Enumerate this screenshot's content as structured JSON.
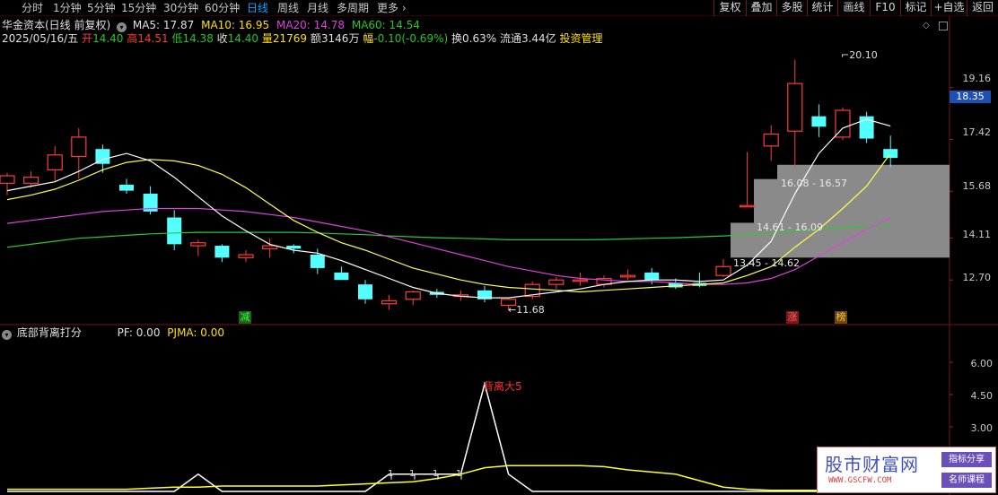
{
  "toolbar": {
    "periods": [
      "分时",
      "1分钟",
      "5分钟",
      "15分钟",
      "30分钟",
      "60分钟",
      "日线",
      "周线",
      "月线",
      "多周期",
      "更多"
    ],
    "active_period": "日线",
    "right_buttons": [
      "复权",
      "叠加",
      "多股",
      "统计",
      "画线",
      "F10",
      "标记",
      "+自选",
      "返回"
    ]
  },
  "header": {
    "stock_title": "华金资本(日线 前复权)",
    "ma5": "MA5: 17.87",
    "ma10": "MA10: 16.95",
    "ma20": "MA20: 14.78",
    "ma60": "MA60: 14.54",
    "date": "2025/05/16/五",
    "open_label": "开",
    "open": "14.40",
    "high_label": "高",
    "high": "14.51",
    "low_label": "低",
    "low": "14.38",
    "close_label": "收",
    "close": "14.40",
    "vol_label": "量",
    "vol": "21769",
    "amt_label": "额",
    "amt": "3146万",
    "chg_label": "幅",
    "chg": "-0.10(-0.69%)",
    "turnover": "换0.63%",
    "float": "流通3.44亿",
    "link": "投资管理"
  },
  "price_axis": [
    "19.16",
    "17.42",
    "15.68",
    "14.11",
    "12.70"
  ],
  "current_price": "18.35",
  "annotations": {
    "high_mark": "20.10",
    "low_mark": "11.68",
    "zone1": "16.08 - 16.57",
    "zone2": "14.61 - 16.09",
    "zone3": "13.45 - 14.62",
    "tag_jian": "减",
    "tag_zhang": "涨",
    "tag_bang": "榜"
  },
  "indicator": {
    "name": "底部背离打分",
    "pf": "PF: 0.00",
    "pjma": "PJMA: 0.00",
    "peak_label": "背离大5",
    "axis": [
      "6.00",
      "4.50",
      "3.00"
    ],
    "ticks": [
      "1",
      "1",
      "1",
      "1"
    ]
  },
  "watermark": {
    "title": "股市财富网",
    "url": "WWW.GSCFW.COM",
    "tag1": "指标分享",
    "tag2": "名师课程"
  },
  "colors": {
    "up": "#ff3c3c",
    "down": "#54ffff",
    "ma5": "#ffffff",
    "ma10": "#ffff50",
    "ma20": "#e040e0",
    "ma60": "#30c830"
  },
  "chart_data": {
    "type": "candlestick",
    "ylim": [
      11.0,
      21.0
    ],
    "candles": [
      {
        "o": 15.95,
        "h": 16.3,
        "l": 15.55,
        "c": 16.2,
        "up": true
      },
      {
        "o": 15.95,
        "h": 16.35,
        "l": 15.8,
        "c": 16.15,
        "up": true
      },
      {
        "o": 16.4,
        "h": 17.2,
        "l": 16.0,
        "c": 16.9,
        "up": true
      },
      {
        "o": 16.85,
        "h": 17.8,
        "l": 16.1,
        "c": 17.5,
        "up": true
      },
      {
        "o": 17.1,
        "h": 17.25,
        "l": 16.3,
        "c": 16.6,
        "up": false
      },
      {
        "o": 15.9,
        "h": 16.1,
        "l": 15.6,
        "c": 15.7,
        "up": false
      },
      {
        "o": 15.6,
        "h": 15.85,
        "l": 14.9,
        "c": 15.0,
        "up": false
      },
      {
        "o": 14.8,
        "h": 15.05,
        "l": 13.7,
        "c": 13.9,
        "up": false
      },
      {
        "o": 13.85,
        "h": 14.05,
        "l": 13.5,
        "c": 13.95,
        "up": true
      },
      {
        "o": 13.85,
        "h": 13.9,
        "l": 13.3,
        "c": 13.45,
        "up": false
      },
      {
        "o": 13.45,
        "h": 13.7,
        "l": 13.3,
        "c": 13.55,
        "up": true
      },
      {
        "o": 13.75,
        "h": 14.1,
        "l": 13.45,
        "c": 13.85,
        "up": true
      },
      {
        "o": 13.85,
        "h": 13.9,
        "l": 13.6,
        "c": 13.75,
        "up": false
      },
      {
        "o": 13.55,
        "h": 13.75,
        "l": 12.9,
        "c": 13.1,
        "up": false
      },
      {
        "o": 12.95,
        "h": 13.15,
        "l": 12.7,
        "c": 12.7,
        "up": false
      },
      {
        "o": 12.55,
        "h": 12.7,
        "l": 11.9,
        "c": 12.05,
        "up": false
      },
      {
        "o": 11.9,
        "h": 12.2,
        "l": 11.7,
        "c": 12.0,
        "up": true
      },
      {
        "o": 12.05,
        "h": 12.35,
        "l": 11.85,
        "c": 12.3,
        "up": true
      },
      {
        "o": 12.3,
        "h": 12.4,
        "l": 12.1,
        "c": 12.2,
        "up": false
      },
      {
        "o": 12.15,
        "h": 12.35,
        "l": 12.0,
        "c": 12.2,
        "up": true
      },
      {
        "o": 12.35,
        "h": 12.5,
        "l": 11.95,
        "c": 12.05,
        "up": false
      },
      {
        "o": 11.85,
        "h": 12.1,
        "l": 11.68,
        "c": 12.05,
        "up": true
      },
      {
        "o": 12.15,
        "h": 12.65,
        "l": 12.05,
        "c": 12.55,
        "up": true
      },
      {
        "o": 12.55,
        "h": 12.8,
        "l": 12.4,
        "c": 12.7,
        "up": true
      },
      {
        "o": 12.7,
        "h": 12.95,
        "l": 12.5,
        "c": 12.7,
        "up": true
      },
      {
        "o": 12.55,
        "h": 12.85,
        "l": 12.45,
        "c": 12.75,
        "up": true
      },
      {
        "o": 12.8,
        "h": 13.05,
        "l": 12.7,
        "c": 12.85,
        "up": true
      },
      {
        "o": 12.95,
        "h": 13.1,
        "l": 12.55,
        "c": 12.7,
        "up": false
      },
      {
        "o": 12.6,
        "h": 12.75,
        "l": 12.4,
        "c": 12.45,
        "up": false
      },
      {
        "o": 12.6,
        "h": 12.95,
        "l": 12.45,
        "c": 12.5,
        "up": false
      },
      {
        "o": 12.85,
        "h": 13.4,
        "l": 12.8,
        "c": 13.15,
        "up": true
      },
      {
        "o": 15.2,
        "h": 17.0,
        "l": 15.2,
        "c": 15.2,
        "up": true
      },
      {
        "o": 17.2,
        "h": 17.9,
        "l": 16.7,
        "c": 17.6,
        "up": true
      },
      {
        "o": 17.7,
        "h": 20.1,
        "l": 16.5,
        "c": 19.3,
        "up": true
      },
      {
        "o": 18.2,
        "h": 18.6,
        "l": 17.5,
        "c": 17.85,
        "up": false
      },
      {
        "o": 17.5,
        "h": 18.5,
        "l": 17.4,
        "c": 18.4,
        "up": true
      },
      {
        "o": 18.2,
        "h": 18.35,
        "l": 17.3,
        "c": 17.45,
        "up": false
      },
      {
        "o": 17.1,
        "h": 17.55,
        "l": 16.5,
        "c": 16.8,
        "up": false
      }
    ],
    "ma5": [
      15.7,
      15.85,
      16.0,
      16.35,
      16.75,
      16.95,
      16.7,
      16.15,
      15.5,
      14.85,
      14.35,
      13.9,
      13.7,
      13.6,
      13.35,
      13.05,
      12.75,
      12.45,
      12.25,
      12.15,
      12.1,
      12.1,
      12.2,
      12.3,
      12.4,
      12.55,
      12.65,
      12.7,
      12.7,
      12.65,
      12.7,
      13.2,
      14.0,
      15.6,
      16.95,
      17.8,
      18.1,
      17.87
    ],
    "ma10": [
      15.4,
      15.55,
      15.75,
      16.05,
      16.4,
      16.65,
      16.75,
      16.7,
      16.55,
      16.25,
      15.8,
      15.25,
      14.7,
      14.3,
      13.95,
      13.7,
      13.4,
      13.1,
      12.9,
      12.7,
      12.55,
      12.45,
      12.4,
      12.35,
      12.3,
      12.35,
      12.4,
      12.45,
      12.5,
      12.55,
      12.6,
      12.85,
      13.15,
      13.8,
      14.4,
      15.1,
      15.85,
      16.95
    ],
    "ma20": [
      14.6,
      14.7,
      14.8,
      14.9,
      15.0,
      15.05,
      15.1,
      15.1,
      15.1,
      15.05,
      15.0,
      14.9,
      14.8,
      14.65,
      14.5,
      14.35,
      14.15,
      13.95,
      13.75,
      13.55,
      13.35,
      13.15,
      13.0,
      12.85,
      12.75,
      12.7,
      12.65,
      12.65,
      12.6,
      12.55,
      12.55,
      12.6,
      12.75,
      13.05,
      13.5,
      13.95,
      14.4,
      14.78
    ],
    "ma60": [
      13.8,
      13.9,
      14.0,
      14.1,
      14.15,
      14.2,
      14.25,
      14.28,
      14.3,
      14.3,
      14.3,
      14.3,
      14.3,
      14.28,
      14.25,
      14.22,
      14.18,
      14.15,
      14.12,
      14.1,
      14.08,
      14.05,
      14.05,
      14.05,
      14.05,
      14.06,
      14.08,
      14.1,
      14.12,
      14.15,
      14.18,
      14.22,
      14.28,
      14.35,
      14.4,
      14.45,
      14.5,
      14.54
    ],
    "indicator_pf": [
      0,
      0,
      0,
      0,
      0,
      0,
      0,
      0,
      0.8,
      0,
      0,
      0,
      0,
      0,
      0,
      0,
      0.8,
      0.8,
      0.8,
      0.8,
      5,
      0.8,
      0,
      0,
      0,
      0,
      0,
      0,
      0,
      0,
      0,
      0,
      0,
      0,
      0,
      0,
      0,
      0
    ],
    "indicator_pjma": [
      0.1,
      0.1,
      0.1,
      0.1,
      0.1,
      0.1,
      0.15,
      0.2,
      0.2,
      0.25,
      0.25,
      0.25,
      0.25,
      0.25,
      0.3,
      0.35,
      0.4,
      0.45,
      0.6,
      0.8,
      1.1,
      1.2,
      1.2,
      1.2,
      1.2,
      1.15,
      1.0,
      0.9,
      0.8,
      0.5,
      0.2,
      0.1,
      0.05,
      0.05,
      0.05,
      0.05,
      0.05,
      0.05
    ]
  }
}
